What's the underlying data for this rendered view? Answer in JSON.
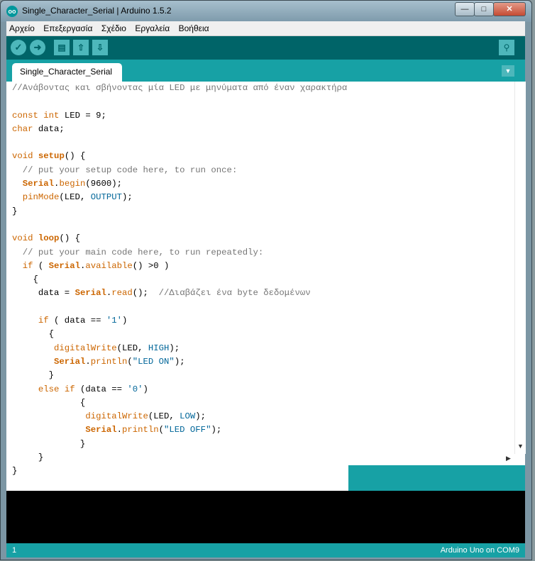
{
  "window": {
    "title": "Single_Character_Serial | Arduino 1.5.2",
    "app_icon": "arduino-icon",
    "controls": [
      "minimize-icon",
      "maximize-icon",
      "close-icon"
    ]
  },
  "menu": [
    "Αρχείο",
    "Επεξεργασία",
    "Σχέδιο",
    "Εργαλεία",
    "Βοήθεια"
  ],
  "toolbar": {
    "buttons": [
      "verify-icon",
      "upload-icon",
      "new-icon",
      "open-icon",
      "save-icon",
      "serial-monitor-icon"
    ]
  },
  "tab": {
    "label": "Single_Character_Serial"
  },
  "code": {
    "comment_header": "//Ανάβοντας και σβήνοντας μία LED με μηνύματα από έναν χαρακτήρα",
    "read_comment": "//Διαβάζει ένα byte δεδομένων"
  },
  "status": {
    "line": "1",
    "board": "Arduino Uno on COM9"
  },
  "colors": {
    "toolbar": "#006468",
    "tabbar": "#17a1a5",
    "button": "#4db7bb",
    "console": "#000000",
    "keyword": "#cc6600",
    "constant": "#006699",
    "comment": "#757575"
  }
}
